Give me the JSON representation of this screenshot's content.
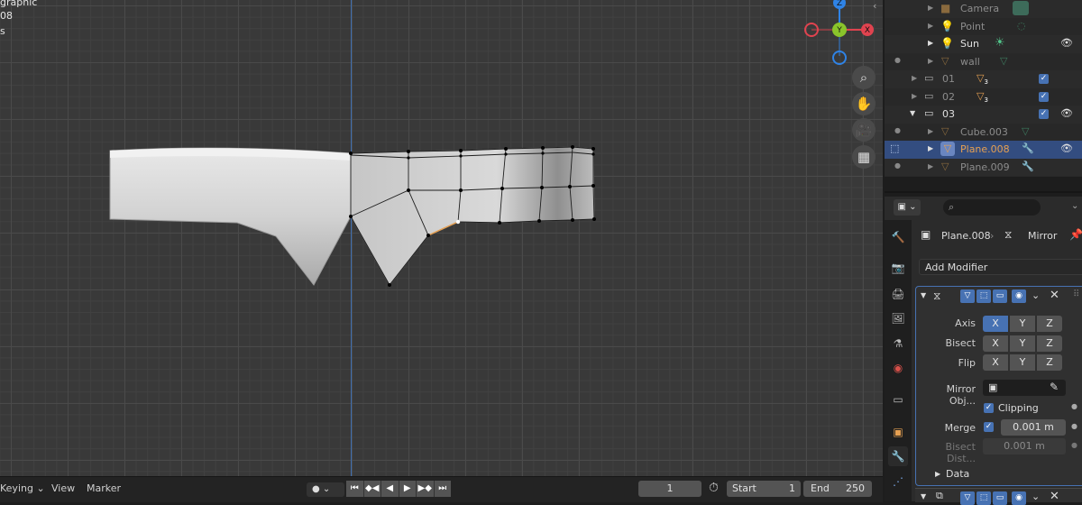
{
  "viewport": {
    "overlay_line1": "graphic",
    "overlay_line2": "08",
    "overlay_line3": "s",
    "gizmo": {
      "z": "Z",
      "y": "Y",
      "x": "X"
    },
    "nav_icons": [
      "zoom-icon",
      "hand-pan-icon",
      "camera-icon",
      "grid-icon"
    ]
  },
  "timeline": {
    "keying": "Keying",
    "view": "View",
    "marker": "Marker",
    "current_frame": "1",
    "start_label": "Start",
    "start_value": "1",
    "end_label": "End",
    "end_value": "250"
  },
  "outliner": {
    "rows": [
      {
        "label": "Camera",
        "dim": true
      },
      {
        "label": "Point",
        "dim": true
      },
      {
        "label": "Sun",
        "dim": false
      },
      {
        "label": "wall",
        "dim": true
      },
      {
        "label": "01",
        "dim": true,
        "count": "3"
      },
      {
        "label": "02",
        "dim": true,
        "count": "3"
      },
      {
        "label": "03",
        "dim": false
      },
      {
        "label": "Cube.003",
        "dim": true
      },
      {
        "label": "Plane.008",
        "selected": true
      },
      {
        "label": "Plane.009",
        "dim": true
      }
    ]
  },
  "properties": {
    "object_name": "Plane.008",
    "modifier_name": "Mirror",
    "add_modifier": "Add Modifier",
    "axis_label": "Axis",
    "bisect_label": "Bisect",
    "flip_label": "Flip",
    "x": "X",
    "y": "Y",
    "z": "Z",
    "mirror_object_label": "Mirror Obj...",
    "clipping_label": "Clipping",
    "merge_label": "Merge",
    "merge_value": "0.001 m",
    "bisect_dist_label": "Bisect Dist...",
    "bisect_dist_value": "0.001 m",
    "data_label": "Data"
  },
  "colors": {
    "selection": "#334d80",
    "accent_blue": "#4772b3",
    "gizmo_x": "#e0434f",
    "gizmo_y": "#8ac42b",
    "gizmo_z": "#2f83e6",
    "object_orange": "#e6a052"
  }
}
